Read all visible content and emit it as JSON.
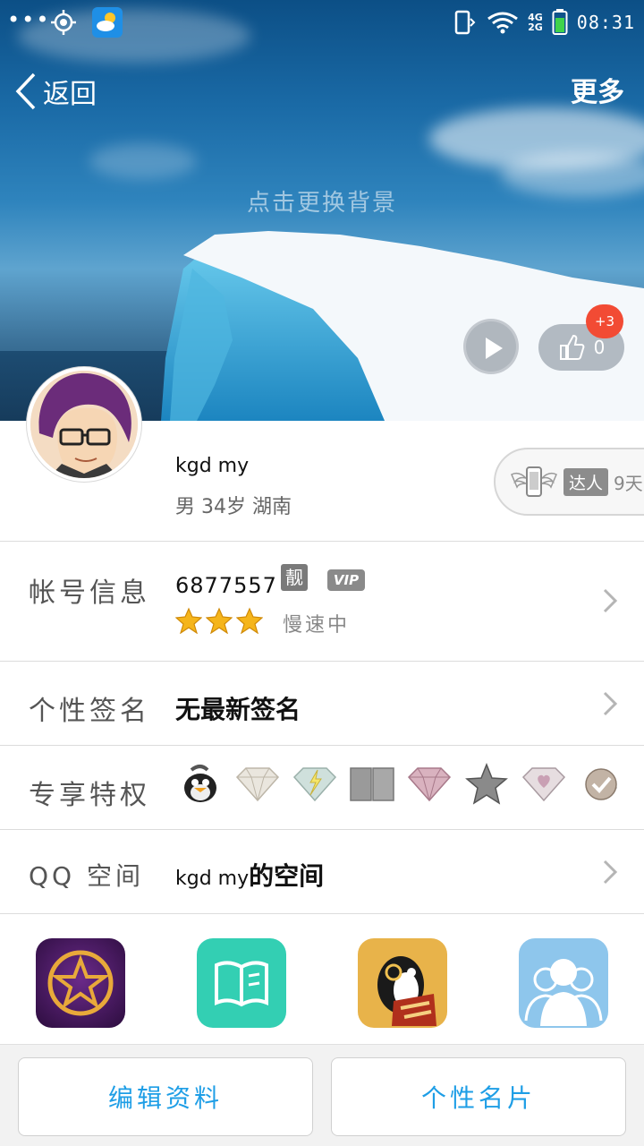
{
  "status_bar": {
    "time": "08:31",
    "network_top": "4G",
    "network_bottom": "2G",
    "icons": [
      "more-dots-icon",
      "location-icon",
      "weather-icon",
      "phone-vibrate-icon",
      "wifi-icon",
      "signal-icon",
      "battery-icon"
    ]
  },
  "header": {
    "back_label": "返回",
    "more_label": "更多",
    "change_background_hint": "点击更换背景"
  },
  "hero": {
    "like_count": "0",
    "like_badge": "+3"
  },
  "profile": {
    "nickname": "kgd my",
    "meta": "男 34岁 湖南",
    "daren_label": "达人",
    "daren_days": "9天"
  },
  "rows": {
    "account": {
      "label": "帐号信息",
      "number": "6877557",
      "liang_badge": "靓",
      "vip_badge": "VIP",
      "level_stars": 3,
      "speed_text": "慢速中"
    },
    "signature": {
      "label": "个性签名",
      "value": "无最新签名"
    },
    "privileges": {
      "label": "专享特权",
      "icons": [
        "penguin-icon",
        "diamond-icon",
        "lightning-diamond-icon",
        "book-icon",
        "pink-diamond-icon",
        "star-icon",
        "heart-diamond-icon",
        "check-coin-icon"
      ]
    },
    "qzone": {
      "label": "QQ 空间",
      "value_name": "kgd my",
      "value_suffix": "的空间"
    }
  },
  "apps": [
    "star-app-icon",
    "reader-app-icon",
    "game-app-icon",
    "contacts-app-icon"
  ],
  "footer": {
    "edit_profile": "编辑资料",
    "personal_card": "个性名片"
  },
  "colors": {
    "accent_blue": "#1e9ee6",
    "badge_red": "#f24b34",
    "star_gold": "#f5b51b"
  }
}
